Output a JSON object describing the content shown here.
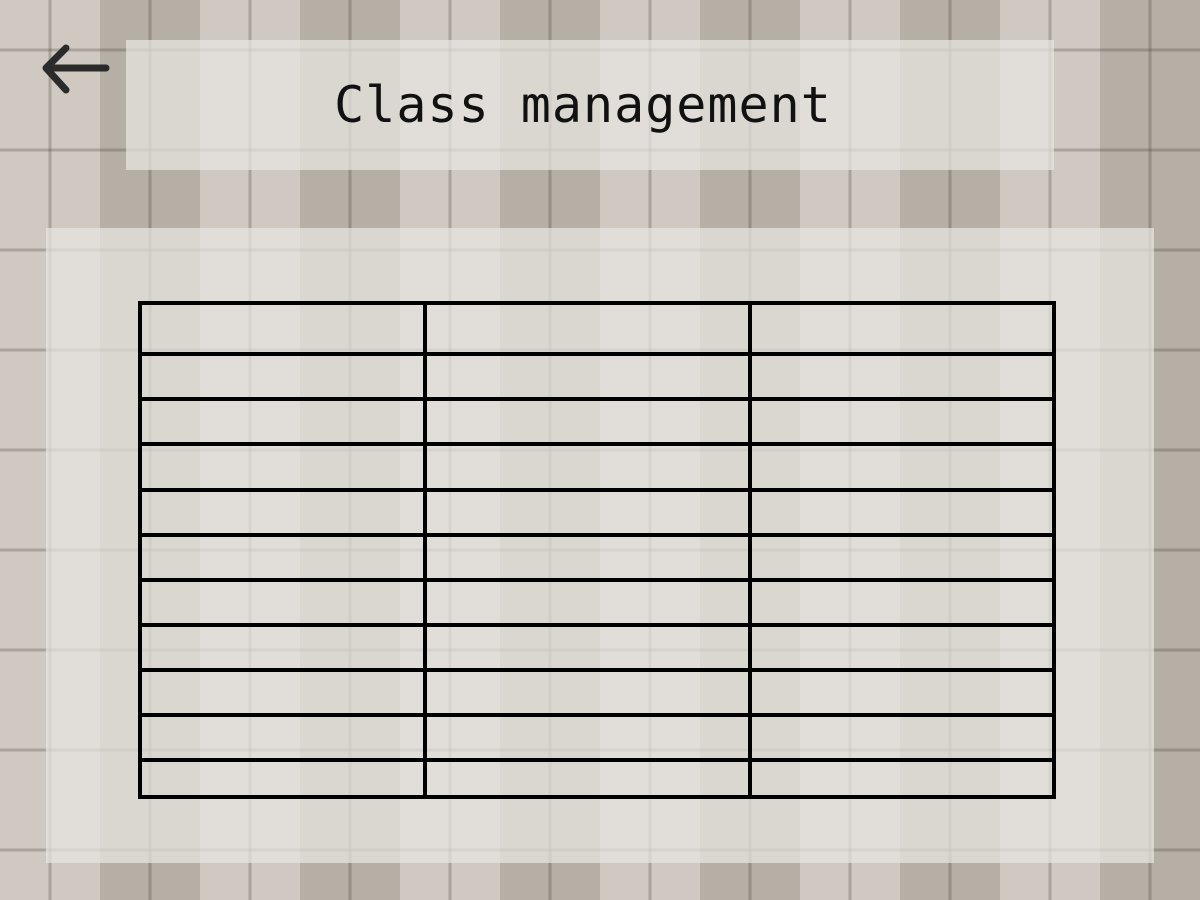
{
  "header": {
    "title": "Class management",
    "back_icon": "arrow-left-icon"
  },
  "table": {
    "columns": 3,
    "rows": [
      [
        "",
        "",
        ""
      ],
      [
        "",
        "",
        ""
      ],
      [
        "",
        "",
        ""
      ],
      [
        "",
        "",
        ""
      ],
      [
        "",
        "",
        ""
      ],
      [
        "",
        "",
        ""
      ],
      [
        "",
        "",
        ""
      ],
      [
        "",
        "",
        ""
      ],
      [
        "",
        "",
        ""
      ],
      [
        "",
        "",
        ""
      ],
      [
        "",
        "",
        ""
      ]
    ]
  },
  "colors": {
    "panel": "#e8e6e2",
    "grid_line": "#000000",
    "icon": "#2b2b2b"
  }
}
